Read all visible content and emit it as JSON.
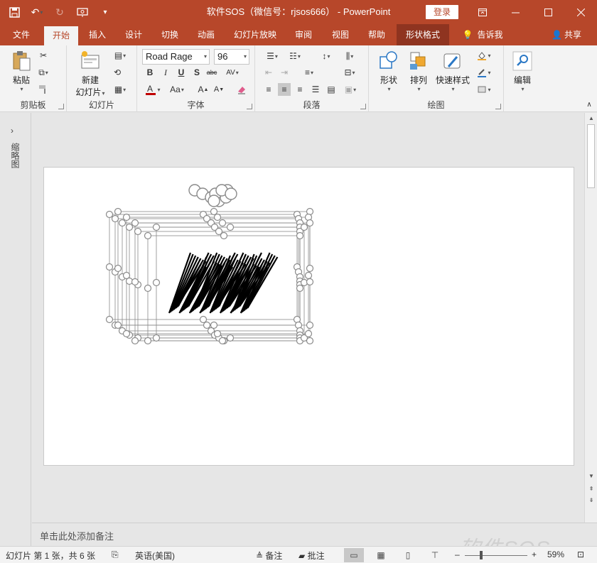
{
  "titlebar": {
    "title": "软件SOS（微信号：rjsos666） - PowerPoint",
    "login_label": "登录"
  },
  "tabs": [
    {
      "label": "文件"
    },
    {
      "label": "开始"
    },
    {
      "label": "插入"
    },
    {
      "label": "设计"
    },
    {
      "label": "切换"
    },
    {
      "label": "动画"
    },
    {
      "label": "幻灯片放映"
    },
    {
      "label": "审阅"
    },
    {
      "label": "视图"
    },
    {
      "label": "帮助"
    },
    {
      "label": "形状格式"
    }
  ],
  "tell_me": "告诉我",
  "share": "共享",
  "ribbon": {
    "clipboard": {
      "label": "剪贴板",
      "paste": "粘贴"
    },
    "slides": {
      "label": "幻灯片",
      "new_slide_line1": "新建",
      "new_slide_line2": "幻灯片"
    },
    "font": {
      "label": "字体",
      "font_name": "Road Rage",
      "font_size": "96"
    },
    "paragraph": {
      "label": "段落"
    },
    "drawing": {
      "label": "绘图",
      "shapes": "形状",
      "arrange": "排列",
      "quick_styles": "快速样式"
    },
    "editing": {
      "label": "编辑"
    }
  },
  "thumb_panel_label": "缩略图",
  "notes_placeholder": "单击此处添加备注",
  "status": {
    "slide_info": "幻灯片 第 1 张，共 6 张",
    "language": "英语(美国)",
    "notes": "备注",
    "comments": "批注",
    "zoom": "59%"
  },
  "watermark": "软件SOS",
  "colors": {
    "accent": "#b7472a",
    "contextual_tab": "#8f3420",
    "font_color_bar": "#c00000"
  }
}
